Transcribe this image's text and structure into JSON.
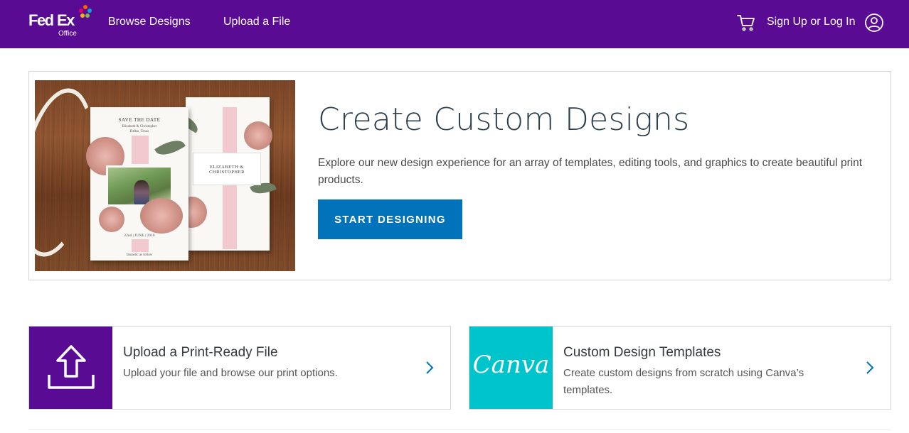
{
  "header": {
    "logo_fed": "Fed",
    "logo_ex": "Ex",
    "logo_office": "Office",
    "nav": [
      {
        "label": "Browse Designs"
      },
      {
        "label": "Upload a File"
      }
    ],
    "signin_label": "Sign Up or Log In",
    "colors": {
      "background": "#5a0b94",
      "text": "#ffffff"
    }
  },
  "hero": {
    "title": "Create Custom Designs",
    "description": "Explore our new design experience for an array of templates, editing tools, and graphics to create beautiful print products.",
    "cta_label": "START DESIGNING",
    "image": {
      "card1_heading": "SAVE THE DATE",
      "card1_names": "Elizabeth & Christopher",
      "card1_place": "Dallas, Texas",
      "card1_date": "22nd | JUNE | 2018",
      "card1_footer": "fantastic as follow",
      "card2_names": "ELIZABETH & CHRISTOPHER"
    },
    "colors": {
      "cta": "#0073bb",
      "title": "#2d3e4c"
    }
  },
  "tiles": [
    {
      "title": "Upload a Print-Ready File",
      "description": "Upload your file and browse our print options.",
      "icon": "upload-icon",
      "icon_bg": "#5a0b94"
    },
    {
      "title": "Custom Design Templates",
      "description": "Create custom designs from scratch using Canva’s templates.",
      "icon": "canva-logo",
      "logo_text": "Canva",
      "icon_bg": "#00c4cc"
    }
  ]
}
